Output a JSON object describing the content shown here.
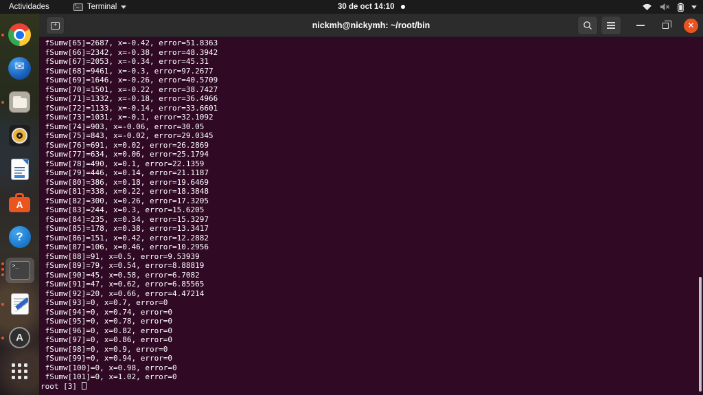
{
  "top_bar": {
    "activities_label": "Actividades",
    "app_menu_label": "Terminal",
    "clock": "30 de oct 14:10",
    "status_icons": [
      "wifi-icon",
      "volume-muted-icon",
      "battery-icon",
      "chevron-down-icon"
    ]
  },
  "dock": {
    "items": [
      {
        "icon": "chrome",
        "running": true
      },
      {
        "icon": "thunderbird",
        "running": false
      },
      {
        "icon": "files",
        "running": true
      },
      {
        "icon": "rhythmbox",
        "running": false
      },
      {
        "icon": "libreoffice-writer",
        "running": false
      },
      {
        "icon": "ubuntu-software",
        "running": false
      },
      {
        "icon": "help",
        "running": false
      },
      {
        "icon": "terminal",
        "running": true,
        "active": true,
        "window_count": 3
      },
      {
        "icon": "text-editor",
        "running": true
      },
      {
        "icon": "app-a",
        "running": true
      },
      {
        "icon": "show-applications",
        "running": false
      }
    ]
  },
  "terminal": {
    "title": "nickmh@nickymh: ~/root/bin",
    "output_lines": [
      " fSumw[65]=2687, x=-0.42, error=51.8363",
      " fSumw[66]=2342, x=-0.38, error=48.3942",
      " fSumw[67]=2053, x=-0.34, error=45.31",
      " fSumw[68]=9461, x=-0.3, error=97.2677",
      " fSumw[69]=1646, x=-0.26, error=40.5709",
      " fSumw[70]=1501, x=-0.22, error=38.7427",
      " fSumw[71]=1332, x=-0.18, error=36.4966",
      " fSumw[72]=1133, x=-0.14, error=33.6601",
      " fSumw[73]=1031, x=-0.1, error=32.1092",
      " fSumw[74]=903, x=-0.06, error=30.05",
      " fSumw[75]=843, x=-0.02, error=29.0345",
      " fSumw[76]=691, x=0.02, error=26.2869",
      " fSumw[77]=634, x=0.06, error=25.1794",
      " fSumw[78]=490, x=0.1, error=22.1359",
      " fSumw[79]=446, x=0.14, error=21.1187",
      " fSumw[80]=386, x=0.18, error=19.6469",
      " fSumw[81]=338, x=0.22, error=18.3848",
      " fSumw[82]=300, x=0.26, error=17.3205",
      " fSumw[83]=244, x=0.3, error=15.6205",
      " fSumw[84]=235, x=0.34, error=15.3297",
      " fSumw[85]=178, x=0.38, error=13.3417",
      " fSumw[86]=151, x=0.42, error=12.2882",
      " fSumw[87]=106, x=0.46, error=10.2956",
      " fSumw[88]=91, x=0.5, error=9.53939",
      " fSumw[89]=79, x=0.54, error=8.88819",
      " fSumw[90]=45, x=0.58, error=6.7082",
      " fSumw[91]=47, x=0.62, error=6.85565",
      " fSumw[92]=20, x=0.66, error=4.47214",
      " fSumw[93]=0, x=0.7, error=0",
      " fSumw[94]=0, x=0.74, error=0",
      " fSumw[95]=0, x=0.78, error=0",
      " fSumw[96]=0, x=0.82, error=0",
      " fSumw[97]=0, x=0.86, error=0",
      " fSumw[98]=0, x=0.9, error=0",
      " fSumw[99]=0, x=0.94, error=0",
      " fSumw[100]=0, x=0.98, error=0",
      " fSumw[101]=0, x=1.02, error=0"
    ],
    "prompt": "root [3] "
  },
  "colors": {
    "terminal_background": "#300a24",
    "accent_orange": "#e95420",
    "titlebar": "#2c2c2c",
    "panel": "#1b1b1b"
  }
}
